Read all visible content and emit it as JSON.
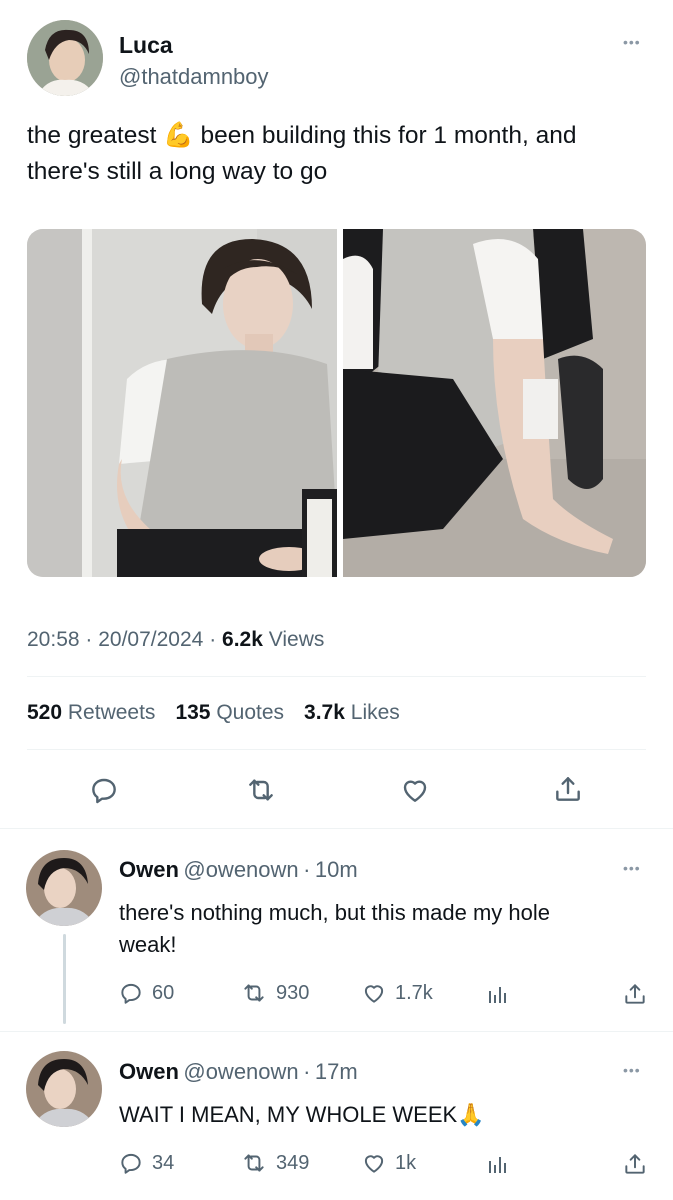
{
  "main_tweet": {
    "author_name": "Luca",
    "author_handle": "@thatdamnboy",
    "text_line1_a": "the greatest",
    "emoji1": "💪",
    "text_line1_b": "been building this for 1 month, and",
    "text_line2": "there's still a long way to go",
    "time": "20:58",
    "date": "20/07/2024",
    "views_count": "6.2k",
    "views_label": "Views",
    "retweets_count": "520",
    "retweets_label": "Retweets",
    "quotes_count": "135",
    "quotes_label": "Quotes",
    "likes_count": "3.7k",
    "likes_label": "Likes"
  },
  "replies": [
    {
      "name": "Owen",
      "handle": "@owenown",
      "time": "10m",
      "text_line1": "there's nothing much, but this made my hole",
      "text_line2": "weak!",
      "replies": "60",
      "retweets": "930",
      "likes": "1.7k"
    },
    {
      "name": "Owen",
      "handle": "@owenown",
      "time": "17m",
      "text_line1": "WAIT I MEAN, MY WHOLE WEEK",
      "emoji": "🙏",
      "replies": "34",
      "retweets": "349",
      "likes": "1k"
    }
  ],
  "icons": {
    "more": "more-horizontal-icon",
    "reply": "reply-icon",
    "retweet": "retweet-icon",
    "like": "heart-icon",
    "share": "share-icon",
    "analytics": "analytics-icon"
  },
  "colors": {
    "text": "#0f1419",
    "muted": "#536471",
    "divider": "#eff3f4"
  }
}
